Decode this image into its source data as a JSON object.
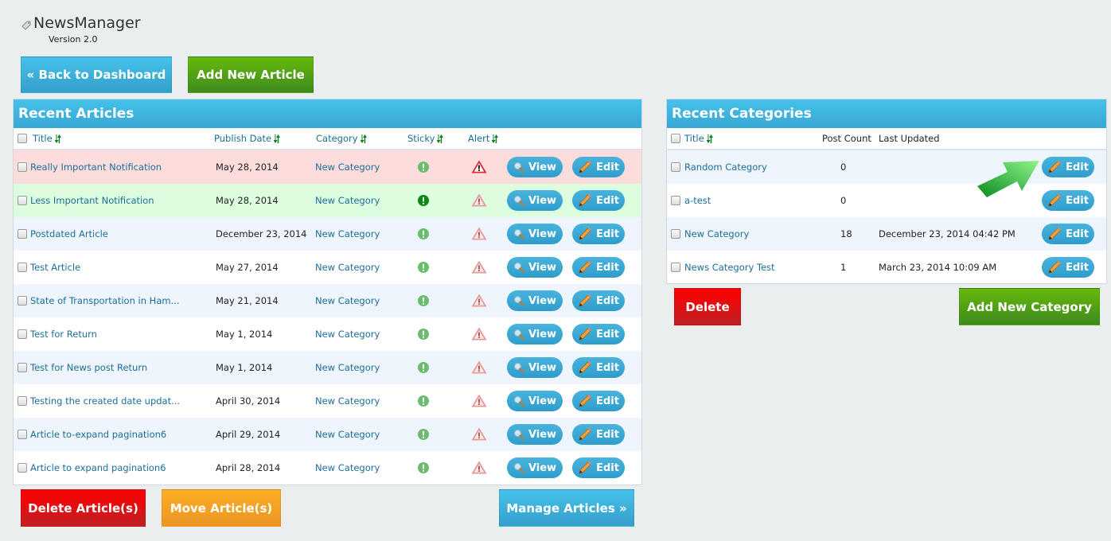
{
  "app": {
    "title": "NewsManager",
    "version": "Version 2.0"
  },
  "top_buttons": {
    "back": "« Back to Dashboard",
    "add_article": "Add New Article"
  },
  "articles": {
    "panel_title": "Recent Articles",
    "columns": {
      "title": "Title",
      "publish_date": "Publish Date",
      "category": "Category",
      "sticky": "Sticky",
      "alert": "Alert"
    },
    "view_label": "View",
    "edit_label": "Edit",
    "rows": [
      {
        "title": "Really Important Notification",
        "date": "May 28, 2014",
        "category": "New Category",
        "sticky": false,
        "alert": true,
        "highlight": "red"
      },
      {
        "title": "Less Important Notification",
        "date": "May 28, 2014",
        "category": "New Category",
        "sticky": true,
        "alert": false,
        "highlight": "green"
      },
      {
        "title": "Postdated Article",
        "date": "December 23, 2014",
        "category": "New Category",
        "sticky": false,
        "alert": false,
        "highlight": "alt"
      },
      {
        "title": "Test Article",
        "date": "May 27, 2014",
        "category": "New Category",
        "sticky": false,
        "alert": false,
        "highlight": "none"
      },
      {
        "title": "State of Transportation in Ham...",
        "date": "May 21, 2014",
        "category": "New Category",
        "sticky": false,
        "alert": false,
        "highlight": "alt"
      },
      {
        "title": "Test for Return",
        "date": "May 1, 2014",
        "category": "New Category",
        "sticky": false,
        "alert": false,
        "highlight": "none"
      },
      {
        "title": "Test for News post Return",
        "date": "May 1, 2014",
        "category": "New Category",
        "sticky": false,
        "alert": false,
        "highlight": "alt"
      },
      {
        "title": "Testing the created date updat...",
        "date": "April 30, 2014",
        "category": "New Category",
        "sticky": false,
        "alert": false,
        "highlight": "none"
      },
      {
        "title": "Article to-expand pagination6",
        "date": "April 29, 2014",
        "category": "New Category",
        "sticky": false,
        "alert": false,
        "highlight": "alt"
      },
      {
        "title": "Article to expand pagination6",
        "date": "April 28, 2014",
        "category": "New Category",
        "sticky": false,
        "alert": false,
        "highlight": "none"
      }
    ],
    "buttons": {
      "delete": "Delete Article(s)",
      "move": "Move Article(s)",
      "manage": "Manage Articles »"
    }
  },
  "categories": {
    "panel_title": "Recent Categories",
    "columns": {
      "title": "Title",
      "post_count": "Post Count",
      "last_updated": "Last Updated"
    },
    "edit_label": "Edit",
    "rows": [
      {
        "title": "Random Category",
        "count": "0",
        "updated": ""
      },
      {
        "title": "a-test",
        "count": "0",
        "updated": ""
      },
      {
        "title": "New Category",
        "count": "18",
        "updated": "December 23, 2014 04:42 PM"
      },
      {
        "title": "News Category Test",
        "count": "1",
        "updated": "March 23, 2014 10:09 AM"
      }
    ],
    "buttons": {
      "delete": "Delete",
      "add": "Add New Category"
    }
  },
  "colors": {
    "accent_blue": "#45c2ea",
    "success_green": "#3e8b1d",
    "danger_red": "#ff0000",
    "warning_orange": "#fbae22",
    "link": "#1c6e99"
  }
}
